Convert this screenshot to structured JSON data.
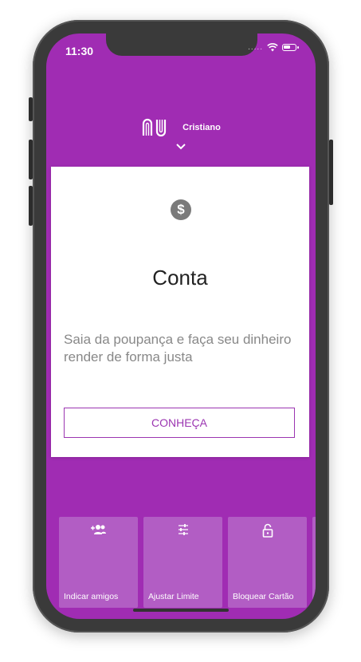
{
  "status_bar": {
    "time": "11:30",
    "dots": "....."
  },
  "header": {
    "user_name": "Cristiano"
  },
  "card": {
    "title": "Conta",
    "description": "Saia da poupança e faça seu dinheiro render de forma justa",
    "cta_label": "CONHEÇA",
    "icon": "dollar-circle-icon"
  },
  "shortcuts": [
    {
      "label": "Indicar amigos",
      "icon": "add-people-icon"
    },
    {
      "label": "Ajustar Limite",
      "icon": "sliders-icon"
    },
    {
      "label": "Bloquear Cartão",
      "icon": "lock-icon"
    }
  ],
  "colors": {
    "brand_purple": "#a02cb3",
    "tile_purple": "#b25dc4",
    "accent": "#9b35b1"
  }
}
